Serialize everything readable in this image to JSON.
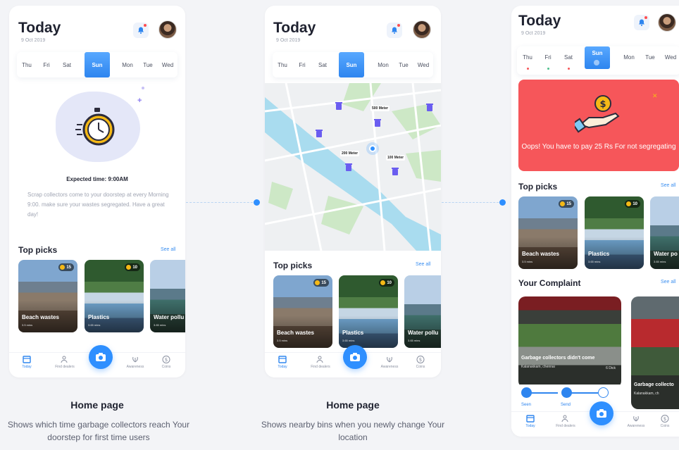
{
  "screens": [
    {
      "title": "Today",
      "date": "9 Oct 2019",
      "days": [
        "Thu",
        "Fri",
        "Sat",
        "Sun",
        "Mon",
        "Tue",
        "Wed"
      ],
      "selected_day": "Sun",
      "expected_time": "Expected time: 9:00AM",
      "description": "Scrap collectors come to your doorstep at every Morning 9:00. make sure your wastes segregated. Have a great day!",
      "top_picks_label": "Top picks",
      "see_all": "See all",
      "picks": [
        {
          "label": "Beach wastes",
          "coins": "15",
          "meta": "3.5 mins"
        },
        {
          "label": "Plastics",
          "coins": "10",
          "meta": "3.65 mins"
        },
        {
          "label": "Water pollu",
          "coins": "",
          "meta": "3.65 mins"
        }
      ],
      "caption_title": "Home page",
      "caption_desc": "Shows which time garbage collectors reach Your doorstep for first time users"
    },
    {
      "title": "Today",
      "date": "9 Oct 2019",
      "days": [
        "Thu",
        "Fri",
        "Sat",
        "Sun",
        "Mon",
        "Tue",
        "Wed"
      ],
      "selected_day": "Sun",
      "map_labels": [
        "500 Meter",
        "200 Meter",
        "100 Meter"
      ],
      "top_picks_label": "Top picks",
      "see_all": "See all",
      "picks": [
        {
          "label": "Beach wastes",
          "coins": "15",
          "meta": "3.5 mins"
        },
        {
          "label": "Plastics",
          "coins": "10",
          "meta": "3.65 mins"
        },
        {
          "label": "Water pollu",
          "coins": "",
          "meta": "3.65 mins"
        }
      ],
      "caption_title": "Home page",
      "caption_desc": "Shows nearby bins when you newly change Your location"
    },
    {
      "title": "Today",
      "date": "9 Oct 2019",
      "days": [
        "Thu",
        "Fri",
        "Sat",
        "Sun",
        "Mon",
        "Tue",
        "Wed"
      ],
      "selected_day": "Sun",
      "alert_text": "Oops! You have to pay 25 Rs For not segregating",
      "top_picks_label": "Top picks",
      "see_all": "See all",
      "picks": [
        {
          "label": "Beach wastes",
          "coins": "15",
          "meta": "3.5 mins"
        },
        {
          "label": "Plastics",
          "coins": "10",
          "meta": "3.65 mins"
        },
        {
          "label": "Water po",
          "coins": "",
          "meta": "3.65 mins"
        }
      ],
      "complaint_label": "Your Complaint",
      "complaint_see_all": "See all",
      "complaints": [
        {
          "title": "Garbage collectors didn't come",
          "place": "Kalanakkam, chennai",
          "time": "6 Dick"
        },
        {
          "title": "Garbage collecto",
          "place": "Kalanakkam, ch",
          "time": ""
        }
      ],
      "steps": [
        "Seen",
        "Send"
      ]
    }
  ],
  "nav": {
    "today": "Today",
    "find_dealers": "Find dealers",
    "awareness": "Awareness",
    "coins": "Coins"
  },
  "colors": {
    "accent": "#2e85ef",
    "alert": "#f6565a",
    "coin": "#f5b916"
  }
}
